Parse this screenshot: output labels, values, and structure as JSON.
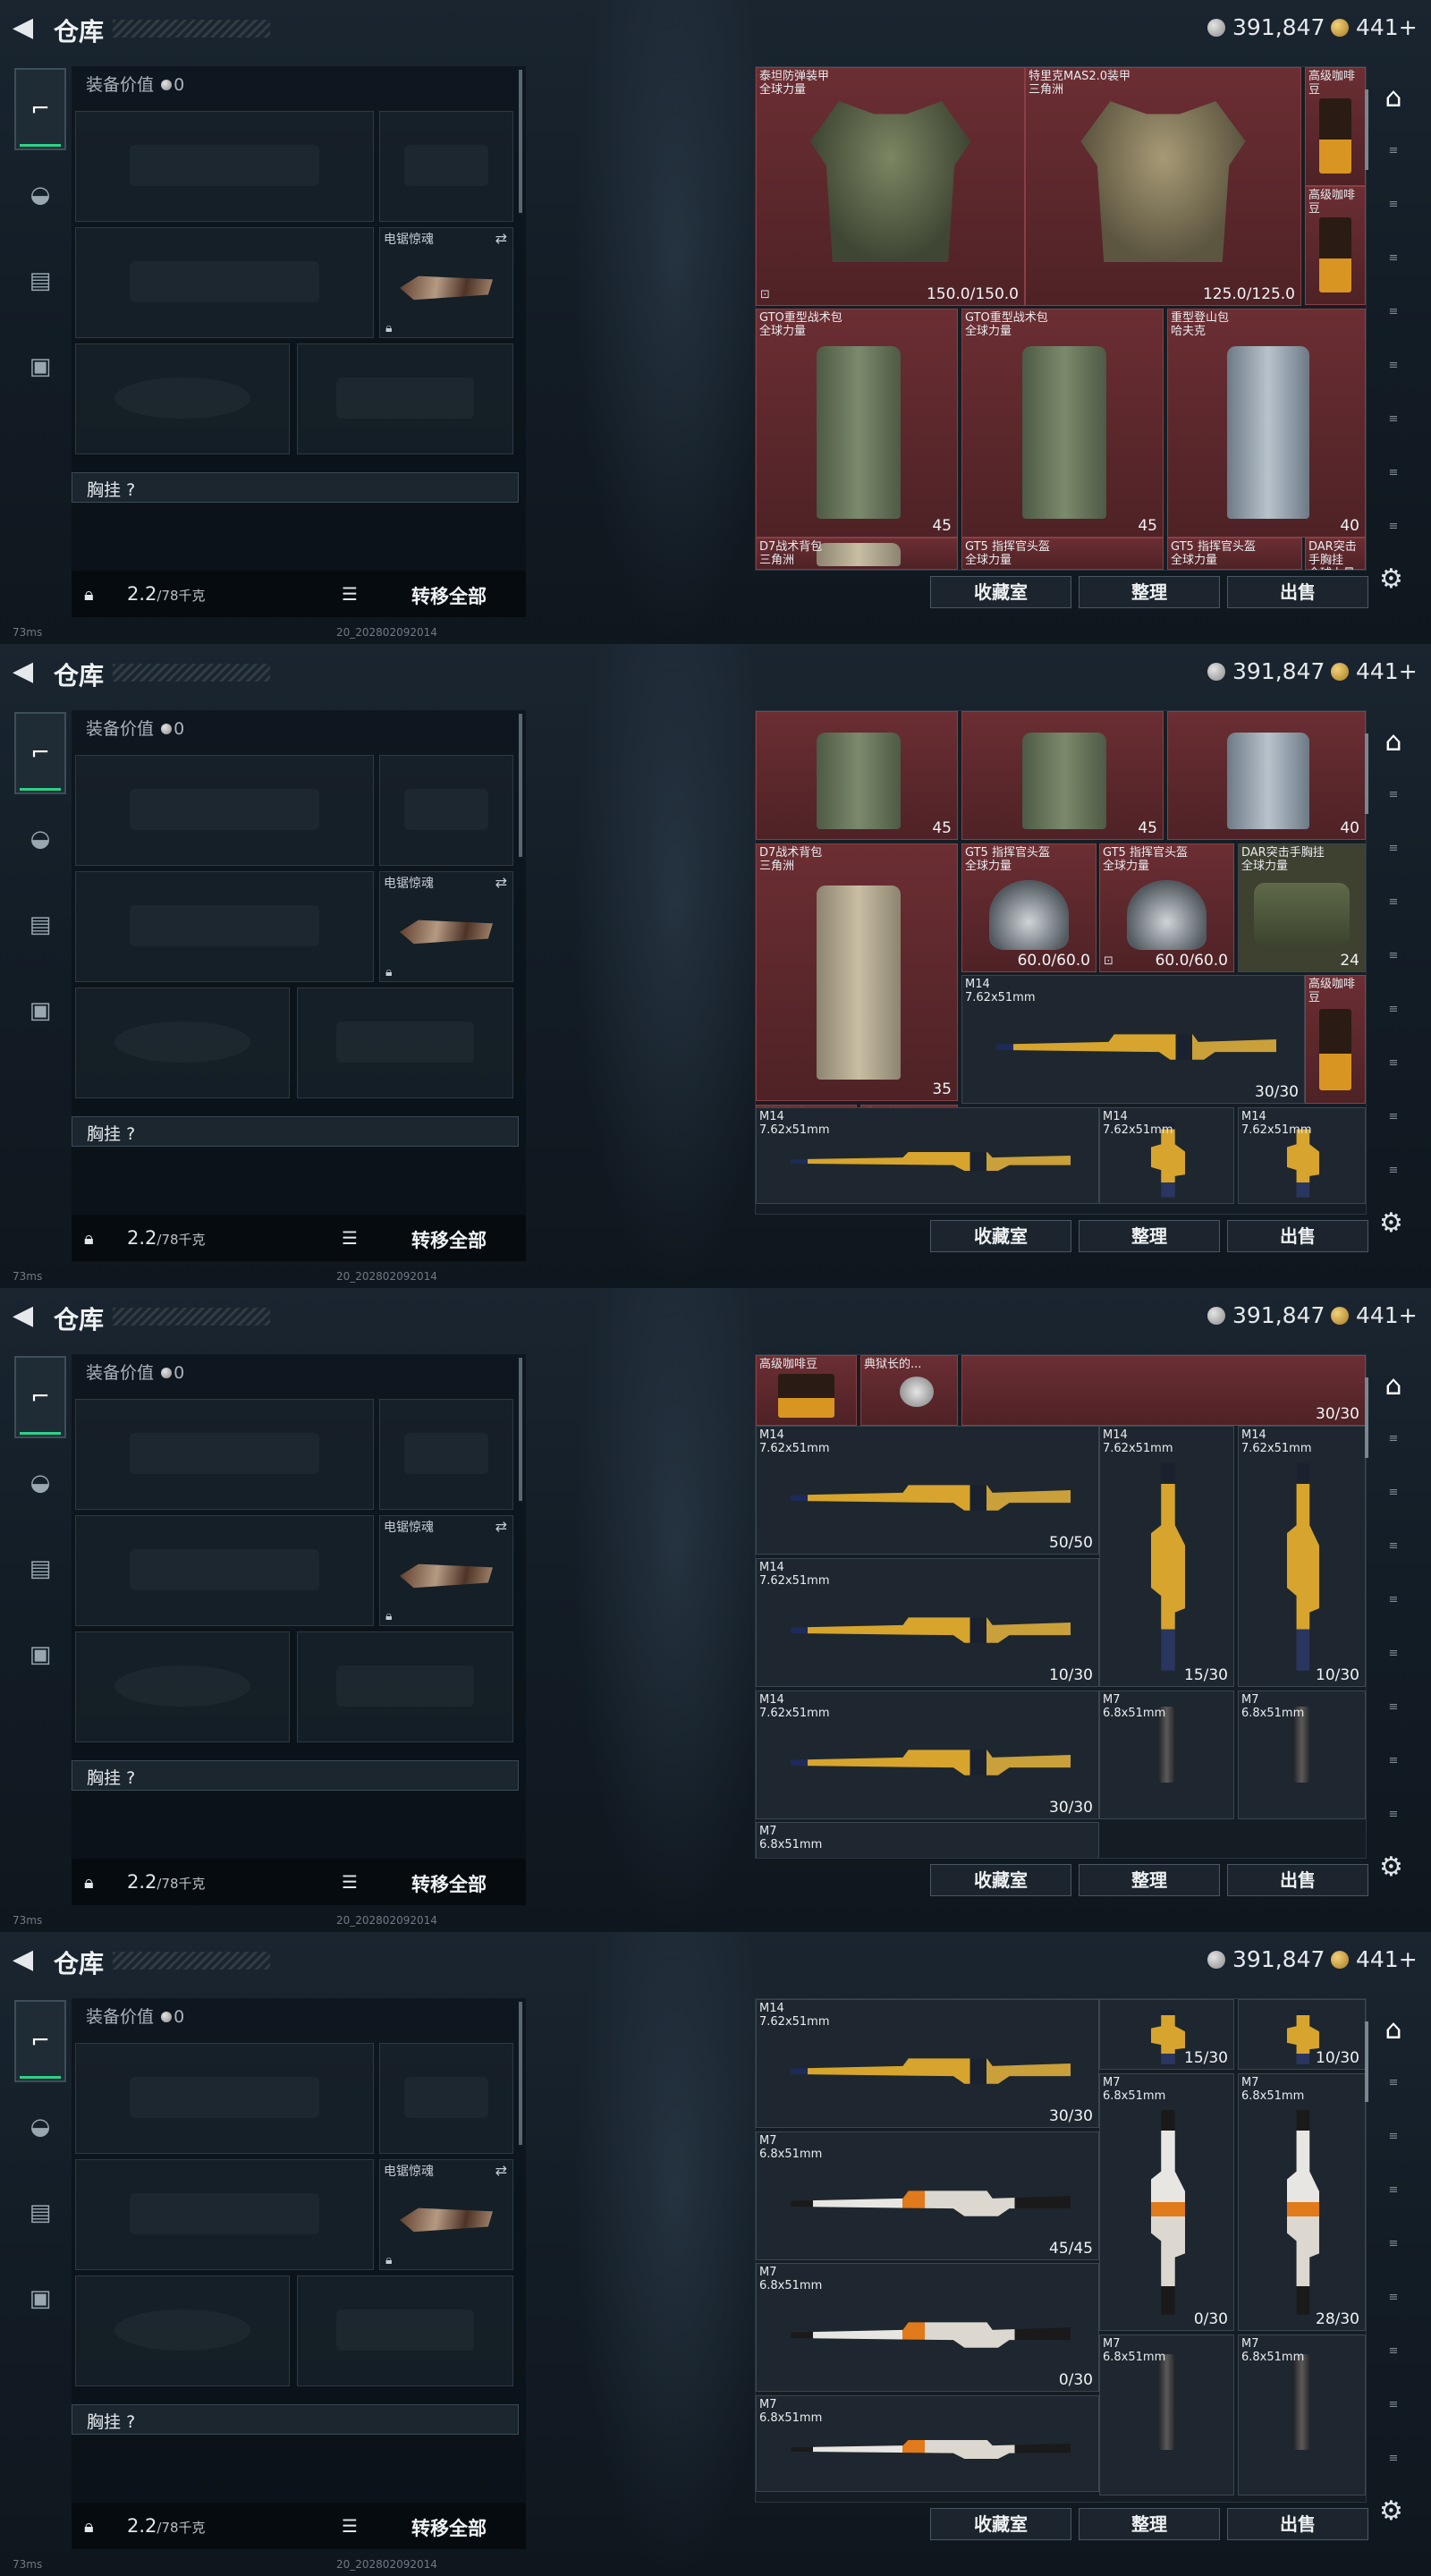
{
  "header": {
    "title": "仓库",
    "currency_silver": "391,847",
    "currency_gold": "441+"
  },
  "loadout": {
    "equip_value_label": "装备价值",
    "equip_value": "0",
    "melee_name": "电锯惊魂",
    "vest_label": "胸挂",
    "vest_hint": "?",
    "weight": "2.2",
    "weight_cap": "/78千克",
    "transfer_all": "转移全部"
  },
  "stash_footer": {
    "collection": "收藏室",
    "sort": "整理",
    "sell": "出售"
  },
  "status": {
    "ping": "73ms",
    "build": "20_20280209201​4"
  },
  "icons": {
    "back": "chevron-left-icon",
    "silver": "silver-coin-icon",
    "gold": "gold-coin-icon",
    "nav": [
      "pistol-icon",
      "helmet-icon",
      "backpack-icon",
      "briefcase-icon"
    ],
    "rail_main": "armor-icon",
    "settings": "gear-icon"
  },
  "screens": [
    {
      "id": "s1",
      "cells": [
        {
          "name": "泰坦防弹装甲\n全球力量",
          "val": "150.0/150.0",
          "art": "armor",
          "bg": "red",
          "corner": "⊡"
        },
        {
          "name": "特里克MAS2.0装甲\n三角洲",
          "val": "125.0/125.0",
          "art": "armor camo",
          "bg": "red"
        },
        {
          "name": "高级咖啡豆",
          "val": "",
          "art": "coffee",
          "bg": "red"
        },
        {
          "name": "高级咖啡豆",
          "val": "",
          "art": "coffee",
          "bg": "red"
        },
        {
          "name": "GTO重型战术包\n全球力量",
          "val": "45",
          "art": "pack",
          "bg": "red",
          "lock": true
        },
        {
          "name": "GTO重型战术包\n全球力量",
          "val": "45",
          "art": "pack",
          "bg": "red",
          "lock": true
        },
        {
          "name": "重型登山包\n哈夫克",
          "val": "40",
          "art": "pack grey",
          "bg": "red",
          "lock": true
        },
        {
          "name": "D7战术背包\n三角洲",
          "val": "",
          "art": "pack tan",
          "bg": "red"
        },
        {
          "name": "GT5 指挥官头盔\n全球力量",
          "val": "",
          "art": "",
          "bg": "red"
        },
        {
          "name": "GT5 指挥官头盔\n全球力量",
          "val": "",
          "art": "",
          "bg": "red"
        },
        {
          "name": "DAR突击手胸挂\n全球力量",
          "val": "",
          "art": "",
          "bg": "red"
        }
      ]
    },
    {
      "id": "s2",
      "cells": [
        {
          "name": "",
          "val": "45",
          "art": "pack",
          "bg": "red",
          "lock": true
        },
        {
          "name": "",
          "val": "45",
          "art": "pack",
          "bg": "red",
          "lock": true
        },
        {
          "name": "",
          "val": "40",
          "art": "pack grey",
          "bg": "red",
          "lock": true
        },
        {
          "name": "D7战术背包\n三角洲",
          "val": "35",
          "art": "pack tan",
          "bg": "red",
          "lock": true
        },
        {
          "name": "GT5 指挥官头盔\n全球力量",
          "val": "60.0/60.0",
          "art": "helmet",
          "bg": "red"
        },
        {
          "name": "GT5 指挥官头盔\n全球力量",
          "val": "60.0/60.0",
          "art": "helmet",
          "bg": "red",
          "corner": "⊡"
        },
        {
          "name": "DAR突击手胸挂\n全球力量",
          "val": "24",
          "art": "bag",
          "bg": "olive",
          "lock": true
        },
        {
          "name": "M14\n7.62x51mm",
          "val": "30/30",
          "art": "gun-h",
          "bg": ""
        },
        {
          "name": "高级咖啡豆",
          "val": "",
          "art": "coffee",
          "bg": "red"
        },
        {
          "name": "高级咖啡豆",
          "val": "",
          "art": "coffee",
          "bg": "red"
        },
        {
          "name": "典狱长的...",
          "val": "",
          "art": "badge",
          "bg": "red"
        },
        {
          "name": "M14\n7.62x51mm",
          "val": "",
          "art": "gun-h",
          "bg": ""
        },
        {
          "name": "M14\n7.62x51mm",
          "val": "",
          "art": "gun-v",
          "bg": ""
        },
        {
          "name": "M14\n7.62x51mm",
          "val": "",
          "art": "gun-v",
          "bg": ""
        }
      ]
    },
    {
      "id": "s3",
      "cells": [
        {
          "name": "高级咖啡豆",
          "val": "",
          "art": "coffee",
          "bg": "red"
        },
        {
          "name": "典狱长的...",
          "val": "",
          "art": "badge",
          "bg": "red"
        },
        {
          "name": "",
          "val": "30/30",
          "art": "",
          "bg": "red"
        },
        {
          "name": "M14\n7.62x51mm",
          "val": "50/50",
          "art": "gun-h",
          "bg": ""
        },
        {
          "name": "M14\n7.62x51mm",
          "val": "15/30",
          "art": "gun-v",
          "bg": ""
        },
        {
          "name": "M14\n7.62x51mm",
          "val": "10/30",
          "art": "gun-v",
          "bg": ""
        },
        {
          "name": "M14\n7.62x51mm",
          "val": "10/30",
          "art": "gun-h",
          "bg": ""
        },
        {
          "name": "M14\n7.62x51mm",
          "val": "30/30",
          "art": "gun-h",
          "bg": ""
        },
        {
          "name": "M7\n6.8x51mm",
          "val": "",
          "art": "silencer",
          "bg": ""
        },
        {
          "name": "M7\n6.8x51mm",
          "val": "",
          "art": "silencer",
          "bg": ""
        },
        {
          "name": "M7\n6.8x51mm",
          "val": "",
          "art": "",
          "bg": ""
        }
      ]
    },
    {
      "id": "s4",
      "cells": [
        {
          "name": "M14\n7.62x51mm",
          "val": "30/30",
          "art": "gun-h",
          "bg": ""
        },
        {
          "name": "",
          "val": "15/30",
          "art": "gun-v",
          "bg": ""
        },
        {
          "name": "",
          "val": "10/30",
          "art": "gun-v",
          "bg": ""
        },
        {
          "name": "M7\n6.8x51mm",
          "val": "45/45",
          "art": "gun-h white",
          "bg": ""
        },
        {
          "name": "M7\n6.8x51mm",
          "val": "0/30",
          "art": "gun-v white",
          "bg": ""
        },
        {
          "name": "M7\n6.8x51mm",
          "val": "28/30",
          "art": "gun-v white",
          "bg": ""
        },
        {
          "name": "M7\n6.8x51mm",
          "val": "0/30",
          "art": "gun-h white",
          "bg": ""
        },
        {
          "name": "M7\n6.8x51mm",
          "val": "",
          "art": "gun-h white",
          "bg": ""
        },
        {
          "name": "M7\n6.8x51mm",
          "val": "",
          "art": "silencer",
          "bg": ""
        },
        {
          "name": "M7\n6.8x51mm",
          "val": "",
          "art": "silencer",
          "bg": ""
        }
      ]
    }
  ]
}
